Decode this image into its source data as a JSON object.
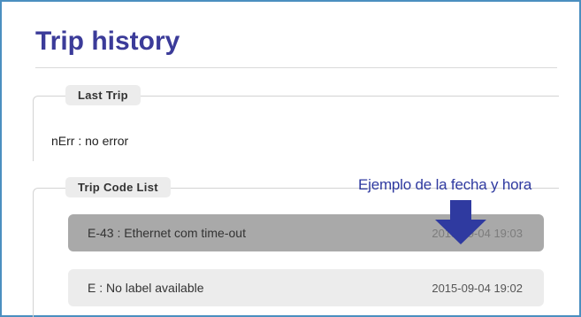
{
  "page": {
    "title": "Trip history"
  },
  "last_trip": {
    "legend": "Last Trip",
    "text": "nErr : no error"
  },
  "trip_code_list": {
    "legend": "Trip Code List",
    "rows": [
      {
        "code": "E-43 : Ethernet com time-out",
        "datetime": "2015-09-04 19:03",
        "selected": true
      },
      {
        "code": "E : No label available",
        "datetime": "2015-09-04 19:02",
        "selected": false
      }
    ]
  },
  "annotation": {
    "text": "Ejemplo de la fecha y hora",
    "arrow_icon": "down-arrow-icon"
  },
  "colors": {
    "title": "#3b3b99",
    "frame_border": "#4b8fc0",
    "annotation": "#2f3aa0",
    "selected_row": "#a9a9a9",
    "normal_row": "#ececec"
  }
}
